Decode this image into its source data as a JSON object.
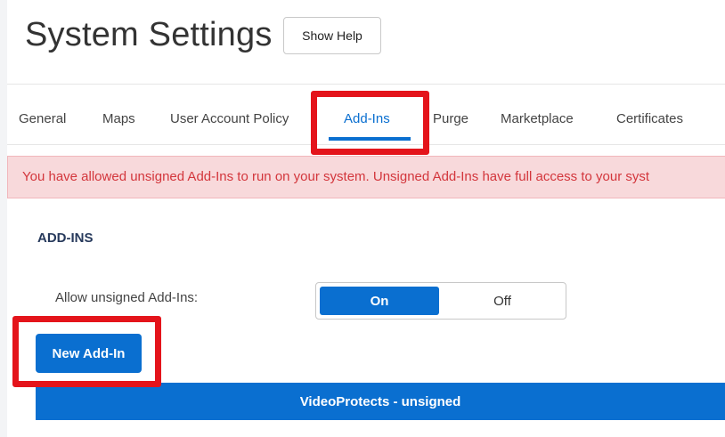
{
  "header": {
    "title": "System Settings",
    "help_button": "Show Help"
  },
  "tabs": [
    {
      "label": "General"
    },
    {
      "label": "Maps"
    },
    {
      "label": "User Account Policy"
    },
    {
      "label": "Add-Ins",
      "active": true
    },
    {
      "label": "Purge"
    },
    {
      "label": "Marketplace"
    },
    {
      "label": "Certificates"
    }
  ],
  "warning": {
    "text": "You have allowed unsigned Add-Ins to run on your system. Unsigned Add-Ins have full access to your syst"
  },
  "addins": {
    "section_title": "ADD-INS",
    "allow_label": "Allow unsigned Add-Ins:",
    "toggle": {
      "on_label": "On",
      "off_label": "Off",
      "selected": "On"
    },
    "new_button": "New Add-In",
    "items": [
      {
        "name": "VideoProtects - unsigned"
      }
    ]
  },
  "colors": {
    "accent": "#0a6fd0",
    "warning_bg": "#f8d9db",
    "warning_text": "#d3363c",
    "highlight": "#e4141b"
  }
}
